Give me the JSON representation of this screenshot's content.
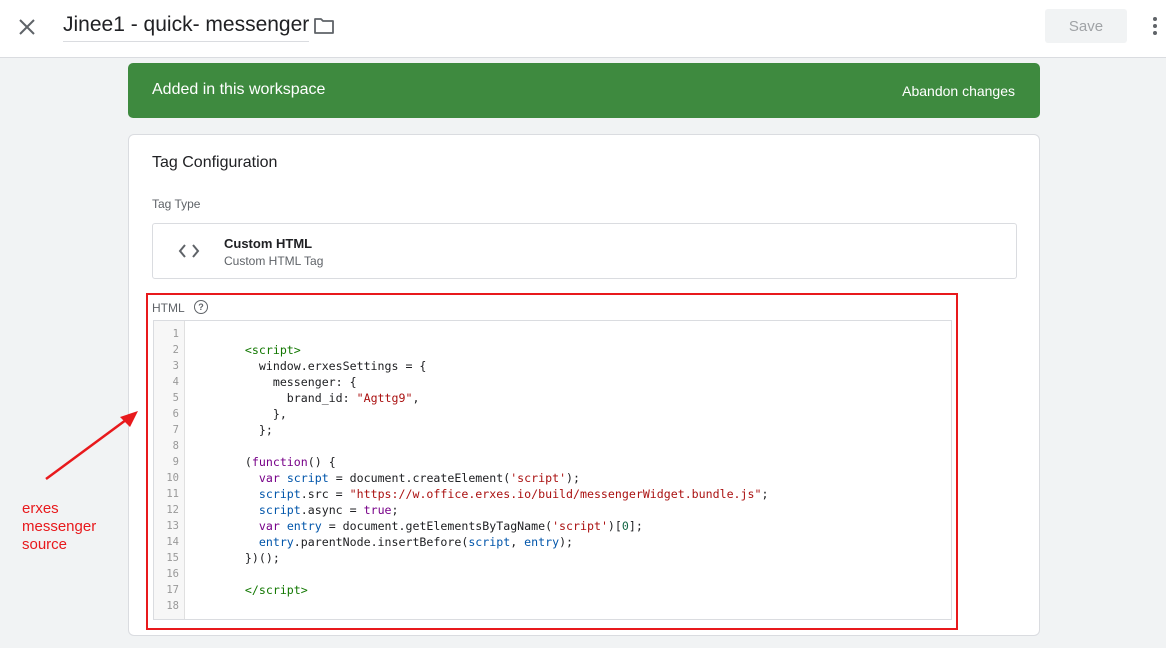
{
  "header": {
    "title": "Jinee1 - quick- messenger",
    "save_label": "Save",
    "close_icon": "close-icon",
    "folder_icon": "folder-icon",
    "more_icon": "more-vert-icon"
  },
  "banner": {
    "text": "Added in this workspace",
    "action": "Abandon changes",
    "color": "#3e8a3f"
  },
  "tag_config": {
    "title": "Tag Configuration",
    "tag_type_label": "Tag Type",
    "tag_type_name": "Custom HTML",
    "tag_type_sub": "Custom HTML Tag",
    "html_label": "HTML",
    "help_glyph": "?"
  },
  "code_lines": [
    {
      "n": "1"
    },
    {
      "n": "2"
    },
    {
      "n": "3"
    },
    {
      "n": "4"
    },
    {
      "n": "5"
    },
    {
      "n": "6"
    },
    {
      "n": "7"
    },
    {
      "n": "8"
    },
    {
      "n": "9"
    },
    {
      "n": "10"
    },
    {
      "n": "11"
    },
    {
      "n": "12"
    },
    {
      "n": "13"
    },
    {
      "n": "14"
    },
    {
      "n": "15"
    },
    {
      "n": "16"
    },
    {
      "n": "17"
    },
    {
      "n": "18"
    }
  ],
  "annotation": {
    "line1": "erxes",
    "line2": "messenger",
    "line3": "source",
    "color": "#e8191c"
  }
}
